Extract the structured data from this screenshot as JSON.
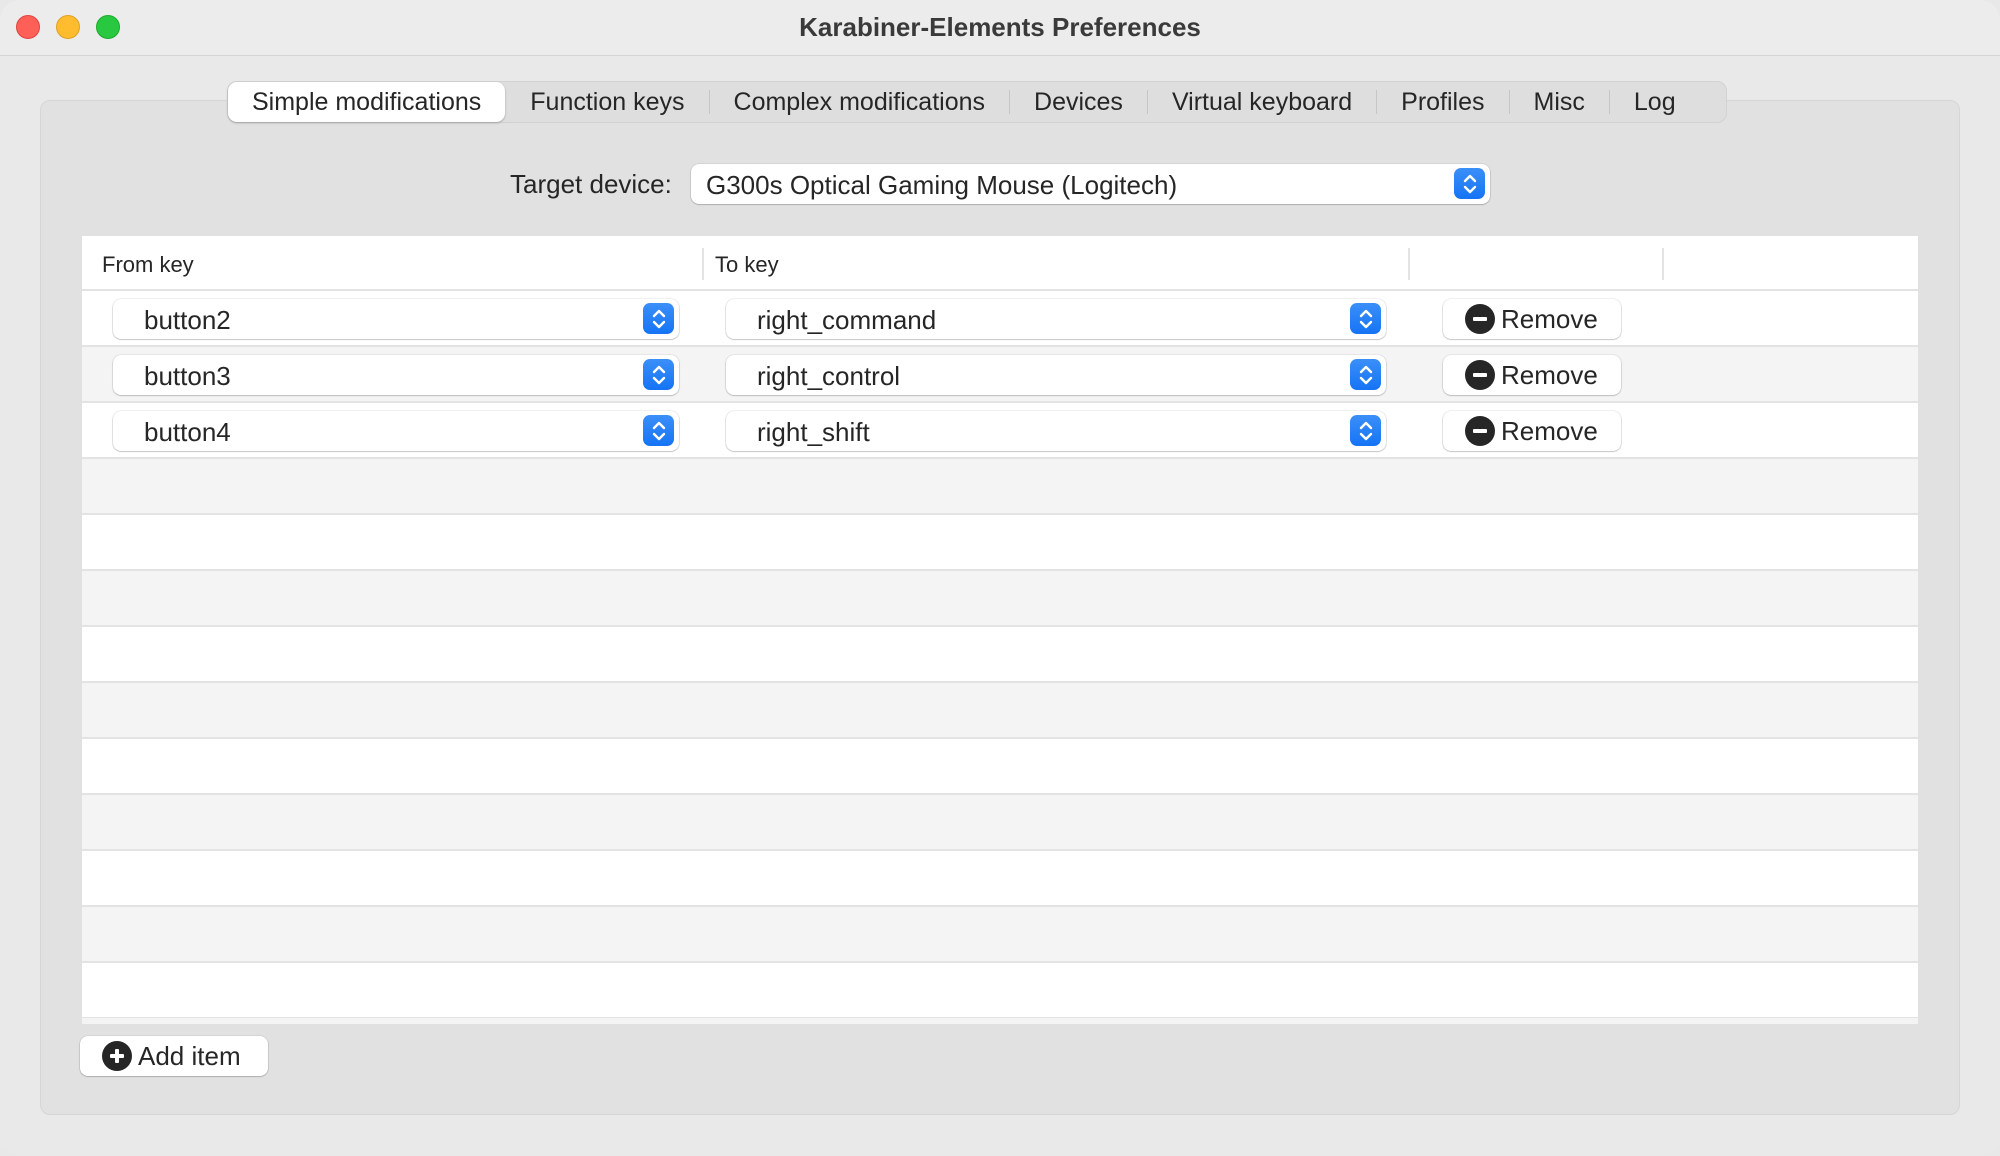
{
  "window": {
    "title": "Karabiner-Elements Preferences"
  },
  "tabs": [
    {
      "label": "Simple modifications",
      "selected": true
    },
    {
      "label": "Function keys",
      "selected": false
    },
    {
      "label": "Complex modifications",
      "selected": false
    },
    {
      "label": "Devices",
      "selected": false
    },
    {
      "label": "Virtual keyboard",
      "selected": false
    },
    {
      "label": "Profiles",
      "selected": false
    },
    {
      "label": "Misc",
      "selected": false
    },
    {
      "label": "Log",
      "selected": false
    }
  ],
  "target_device": {
    "label": "Target device:",
    "value": "G300s Optical Gaming Mouse (Logitech)"
  },
  "table": {
    "columns": [
      "From key",
      "To key",
      "",
      ""
    ],
    "rows": [
      {
        "from": "button2",
        "to": "right_command",
        "action": "Remove"
      },
      {
        "from": "button3",
        "to": "right_control",
        "action": "Remove"
      },
      {
        "from": "button4",
        "to": "right_shift",
        "action": "Remove"
      }
    ],
    "empty_rows": 10
  },
  "add_item_label": "Add item",
  "icons": {
    "stepper": "chevron-up-down-icon",
    "remove": "minus-circle-icon",
    "add": "plus-circle-icon"
  },
  "colors": {
    "accent": "#1a78f6",
    "close": "#fe5f57",
    "minimize": "#febc2e",
    "maximize": "#28c840"
  }
}
